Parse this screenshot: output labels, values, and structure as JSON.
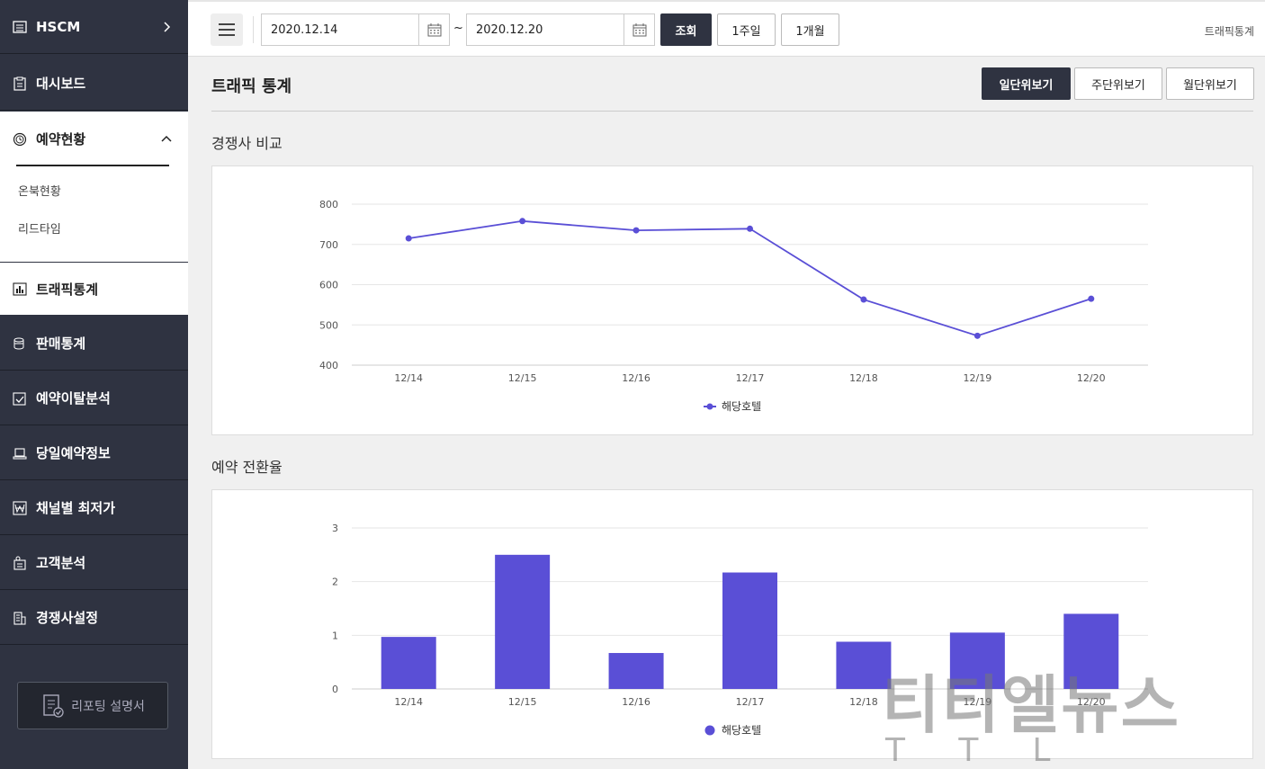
{
  "sidebar": {
    "brand": "HSCM",
    "items": [
      {
        "label": "대시보드",
        "icon": "clipboard-icon"
      },
      {
        "label": "예약현황",
        "icon": "clock-icon"
      },
      {
        "label": "트래픽통계",
        "icon": "bar-chart-icon"
      },
      {
        "label": "판매통계",
        "icon": "coins-icon"
      },
      {
        "label": "예약이탈분석",
        "icon": "checklist-icon"
      },
      {
        "label": "당일예약정보",
        "icon": "laptop-icon"
      },
      {
        "label": "채널별 최저가",
        "icon": "won-icon"
      },
      {
        "label": "고객분석",
        "icon": "customer-icon"
      },
      {
        "label": "경쟁사설정",
        "icon": "building-icon"
      }
    ],
    "subitems": [
      "온북현황",
      "리드타임"
    ],
    "manual_label": "리포팅 설명서"
  },
  "topbar": {
    "start_date": "2020.12.14",
    "end_date": "2020.12.20",
    "tilde": "~",
    "search_label": "조회",
    "week_label": "1주일",
    "month_label": "1개월",
    "breadcrumb": "트래픽통계"
  },
  "main": {
    "title": "트래픽 통계",
    "views": [
      "일단위보기",
      "주단위보기",
      "월단위보기"
    ],
    "active_view": "일단위보기",
    "section1_title": "경쟁사 비교",
    "section2_title": "예약 전환율"
  },
  "colors": {
    "series": "#5a4fd6",
    "sidebar": "#2f3341"
  },
  "chart_data": [
    {
      "type": "line",
      "categories": [
        "12/14",
        "12/15",
        "12/16",
        "12/17",
        "12/18",
        "12/19",
        "12/20"
      ],
      "series": [
        {
          "name": "해당호텔",
          "values": [
            715,
            758,
            735,
            739,
            563,
            473,
            565
          ]
        }
      ],
      "yticks": [
        400,
        500,
        600,
        700,
        800
      ],
      "ylim": [
        400,
        800
      ],
      "grid": true,
      "legend": "bottom"
    },
    {
      "type": "bar",
      "categories": [
        "12/14",
        "12/15",
        "12/16",
        "12/17",
        "12/18",
        "12/19",
        "12/20"
      ],
      "series": [
        {
          "name": "해당호텔",
          "values": [
            0.97,
            2.5,
            0.67,
            2.17,
            0.88,
            1.05,
            1.4
          ]
        }
      ],
      "yticks": [
        0,
        1,
        2,
        3
      ],
      "ylim": [
        0,
        3
      ],
      "grid": true,
      "legend": "bottom"
    }
  ],
  "watermark": {
    "main": "티티엘뉴스",
    "sub": "TTL"
  }
}
